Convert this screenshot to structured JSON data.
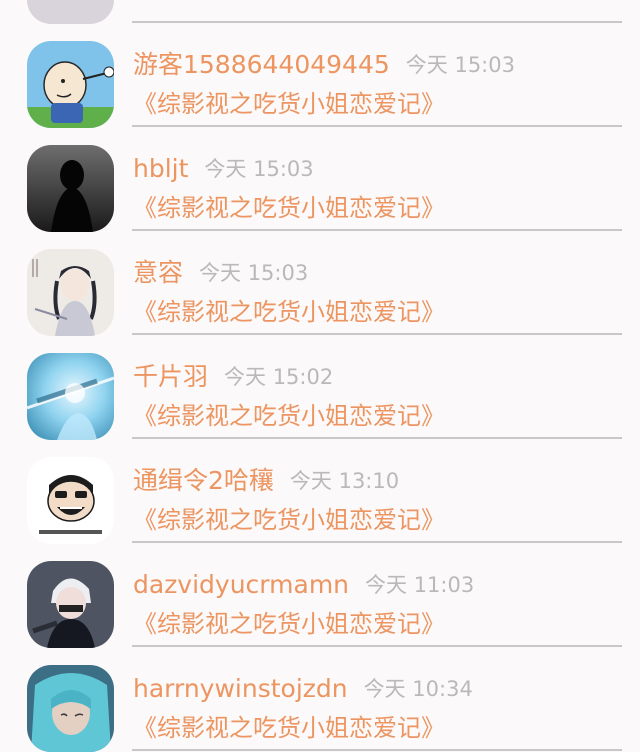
{
  "rows": [
    {
      "name": "",
      "time": "",
      "title": ""
    },
    {
      "name": "游客1588644049445",
      "time": "今天 15:03",
      "title": "《综影视之吃货小姐恋爱记》"
    },
    {
      "name": "hbljt",
      "time": "今天 15:03",
      "title": "《综影视之吃货小姐恋爱记》"
    },
    {
      "name": "意容",
      "time": "今天 15:03",
      "title": "《综影视之吃货小姐恋爱记》"
    },
    {
      "name": "千片羽",
      "time": "今天 15:02",
      "title": "《综影视之吃货小姐恋爱记》"
    },
    {
      "name": "通缉令2哈穰",
      "time": "今天 13:10",
      "title": "《综影视之吃货小姐恋爱记》"
    },
    {
      "name": "dazvidyucrmamn",
      "time": "今天 11:03",
      "title": "《综影视之吃货小姐恋爱记》"
    },
    {
      "name": "harrnywinstojzdn",
      "time": "今天 10:34",
      "title": "《综影视之吃货小姐恋爱记》"
    }
  ],
  "colors": {
    "accent": "#ec9561",
    "time": "#b9b9b9",
    "divider": "#c8c8c8",
    "background": "#fbf9f9"
  }
}
